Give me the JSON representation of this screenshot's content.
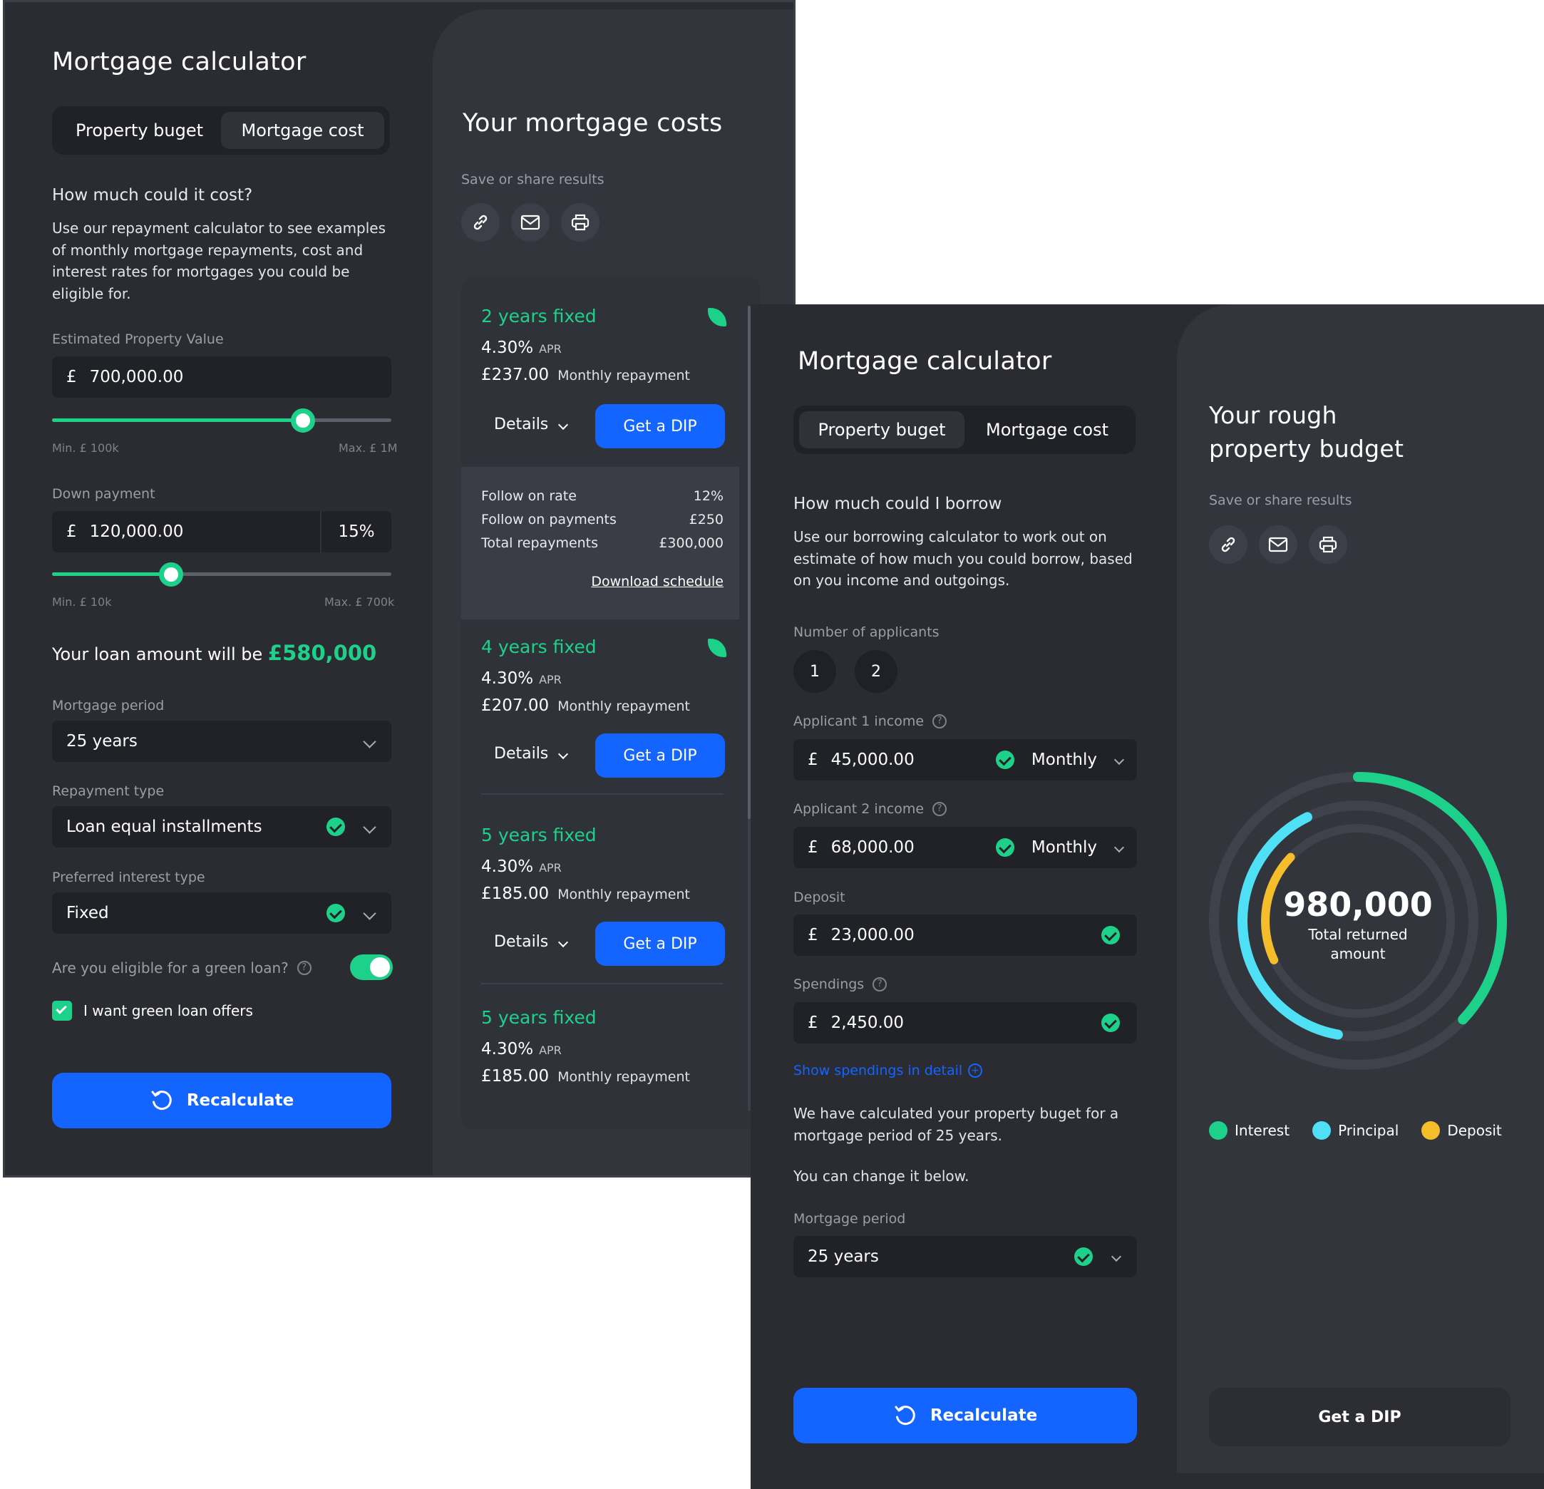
{
  "cost_calc": {
    "title": "Mortgage calculator",
    "tabs": [
      "Property buget",
      "Mortgage cost"
    ],
    "active_tab": "Mortgage cost",
    "heading": "How much could it cost?",
    "description": "Use our repayment calculator to see examples of monthly mortgage repayments, cost and interest rates for mortgages you could be eligible for.",
    "property_value": {
      "label": "Estimated Property Value",
      "currency": "£",
      "value": "700,000.00",
      "min": "Min. £ 100k",
      "max": "Max. £ 1M",
      "level": 0.74
    },
    "down_payment": {
      "label": "Down payment",
      "currency": "£",
      "value": "120,000.00",
      "percent": "15%",
      "min": "Min. £ 10k",
      "max": "Max. £ 700k",
      "level": 0.35
    },
    "loan_prefix": "Your loan amount will be",
    "loan_amount": "£580,000",
    "period": {
      "label": "Mortgage period",
      "value": "25 years"
    },
    "repayment_type": {
      "label": "Repayment type",
      "value": "Loan equal installments"
    },
    "interest_type": {
      "label": "Preferred interest type",
      "value": "Fixed"
    },
    "green_question": "Are you eligible for a green loan?",
    "green_toggle": true,
    "green_offers": "I want green loan offers",
    "green_offers_checked": true,
    "recalculate": "Recalculate"
  },
  "costs": {
    "title": "Your mortgage costs",
    "share_label": "Save or share results",
    "share_icons": [
      "link-icon",
      "mail-icon",
      "print-icon"
    ],
    "offers": [
      {
        "title": "2 years fixed",
        "rate": "4.30%",
        "apr_label": "APR",
        "monthly": "£237.00",
        "monthly_label": "Monthly repayment",
        "details": "Details",
        "dip": "Get a DIP",
        "green": true
      },
      {
        "title": "4 years fixed",
        "rate": "4.30%",
        "apr_label": "APR",
        "monthly": "£207.00",
        "monthly_label": "Monthly repayment",
        "details": "Details",
        "dip": "Get a DIP",
        "green": true
      },
      {
        "title": "5 years fixed",
        "rate": "4.30%",
        "apr_label": "APR",
        "monthly": "£185.00",
        "monthly_label": "Monthly repayment",
        "details": "Details",
        "dip": "Get a DIP",
        "green": false
      },
      {
        "title": "5 years fixed",
        "rate": "4.30%",
        "apr_label": "APR",
        "monthly": "£185.00",
        "monthly_label": "Monthly repayment",
        "green": false
      }
    ],
    "followon": [
      {
        "label": "Follow on rate",
        "value": "12%"
      },
      {
        "label": "Follow on payments",
        "value": "£250"
      },
      {
        "label": "Total repayments",
        "value": "£300,000"
      }
    ],
    "download": "Download schedule"
  },
  "budget_calc": {
    "title": "Mortgage calculator",
    "tabs": [
      "Property buget",
      "Mortgage cost"
    ],
    "active_tab": "Property buget",
    "heading": "How much could I borrow",
    "description": "Use our borrowing calculator to work out on estimate of how much you could borrow, based on you income and outgoings.",
    "applicants_label": "Number of applicants",
    "applicants": [
      "1",
      "2"
    ],
    "income1": {
      "label": "Applicant 1 income",
      "currency": "£",
      "value": "45,000.00",
      "frequency": "Monthly"
    },
    "income2": {
      "label": "Applicant 2 income",
      "currency": "£",
      "value": "68,000.00",
      "frequency": "Monthly"
    },
    "deposit": {
      "label": "Deposit",
      "currency": "£",
      "value": "23,000.00"
    },
    "spendings": {
      "label": "Spendings",
      "currency": "£",
      "value": "2,450.00"
    },
    "spendings_link": "Show spendings in detail",
    "calc_note": "We have calculated your property buget for a mortgage period of 25 years.",
    "change_note": "You can change it below.",
    "period": {
      "label": "Mortgage period",
      "value": "25 years"
    },
    "recalculate": "Recalculate"
  },
  "budget_result": {
    "title_line1": "Your rough",
    "title_line2": "property budget",
    "share_label": "Save or share results",
    "total": "980,000",
    "total_label_line1": "Total returned",
    "total_label_line2": "amount",
    "rings": [
      {
        "name": "Interest",
        "color": "#1ed18a",
        "fraction": 0.37
      },
      {
        "name": "Principal",
        "color": "#4fe0f5",
        "fraction": 0.4
      },
      {
        "name": "Deposit",
        "color": "#f6bd2b",
        "fraction": 0.19
      }
    ],
    "legend": [
      "Interest",
      "Principal",
      "Deposit"
    ],
    "dip": "Get a DIP"
  },
  "colors": {
    "accent_green": "#1ed18a",
    "primary_blue": "#1464ff",
    "panel_bg": "#2a2c32",
    "card_bg": "#32353c"
  }
}
